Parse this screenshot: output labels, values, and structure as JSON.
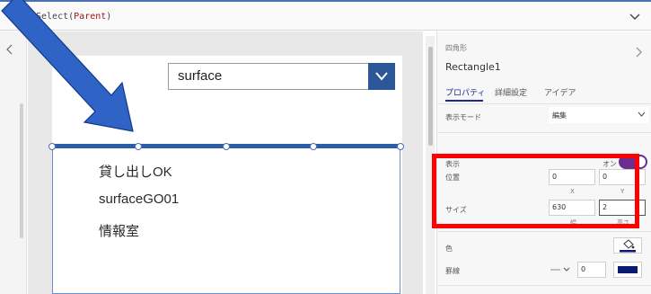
{
  "formula": {
    "func": "Select(",
    "arg": "Parent",
    "close": ")"
  },
  "canvas": {
    "dropdown_value": "surface",
    "gallery_labels": [
      "貸し出しOK",
      "surfaceGO01",
      "情報室"
    ]
  },
  "properties": {
    "control_type": "四角形",
    "control_name": "Rectangle1",
    "tabs": [
      "プロパティ",
      "詳細設定",
      "アイデア"
    ],
    "display_mode_label": "表示モード",
    "display_mode_value": "編集",
    "visible_label": "表示",
    "visible_toggle_text": "オン",
    "position_label": "位置",
    "position_x": "0",
    "position_y": "0",
    "x_caption": "X",
    "y_caption": "Y",
    "size_label": "サイズ",
    "width": "630",
    "height": "2",
    "width_caption": "幅",
    "height_caption": "高さ",
    "color_label": "色",
    "border_label": "罫線",
    "border_width": "0"
  },
  "colors": {
    "accent": "#2b5797",
    "toggle_on": "#6b2d8f",
    "highlight": "#ff0000",
    "arrow": "#2f63c6",
    "border_color": "#0a1a6e"
  },
  "icons": [
    "chevron-down-icon",
    "chevron-left-icon",
    "chevron-right-icon",
    "paint-bucket-icon",
    "annotation-arrow"
  ]
}
